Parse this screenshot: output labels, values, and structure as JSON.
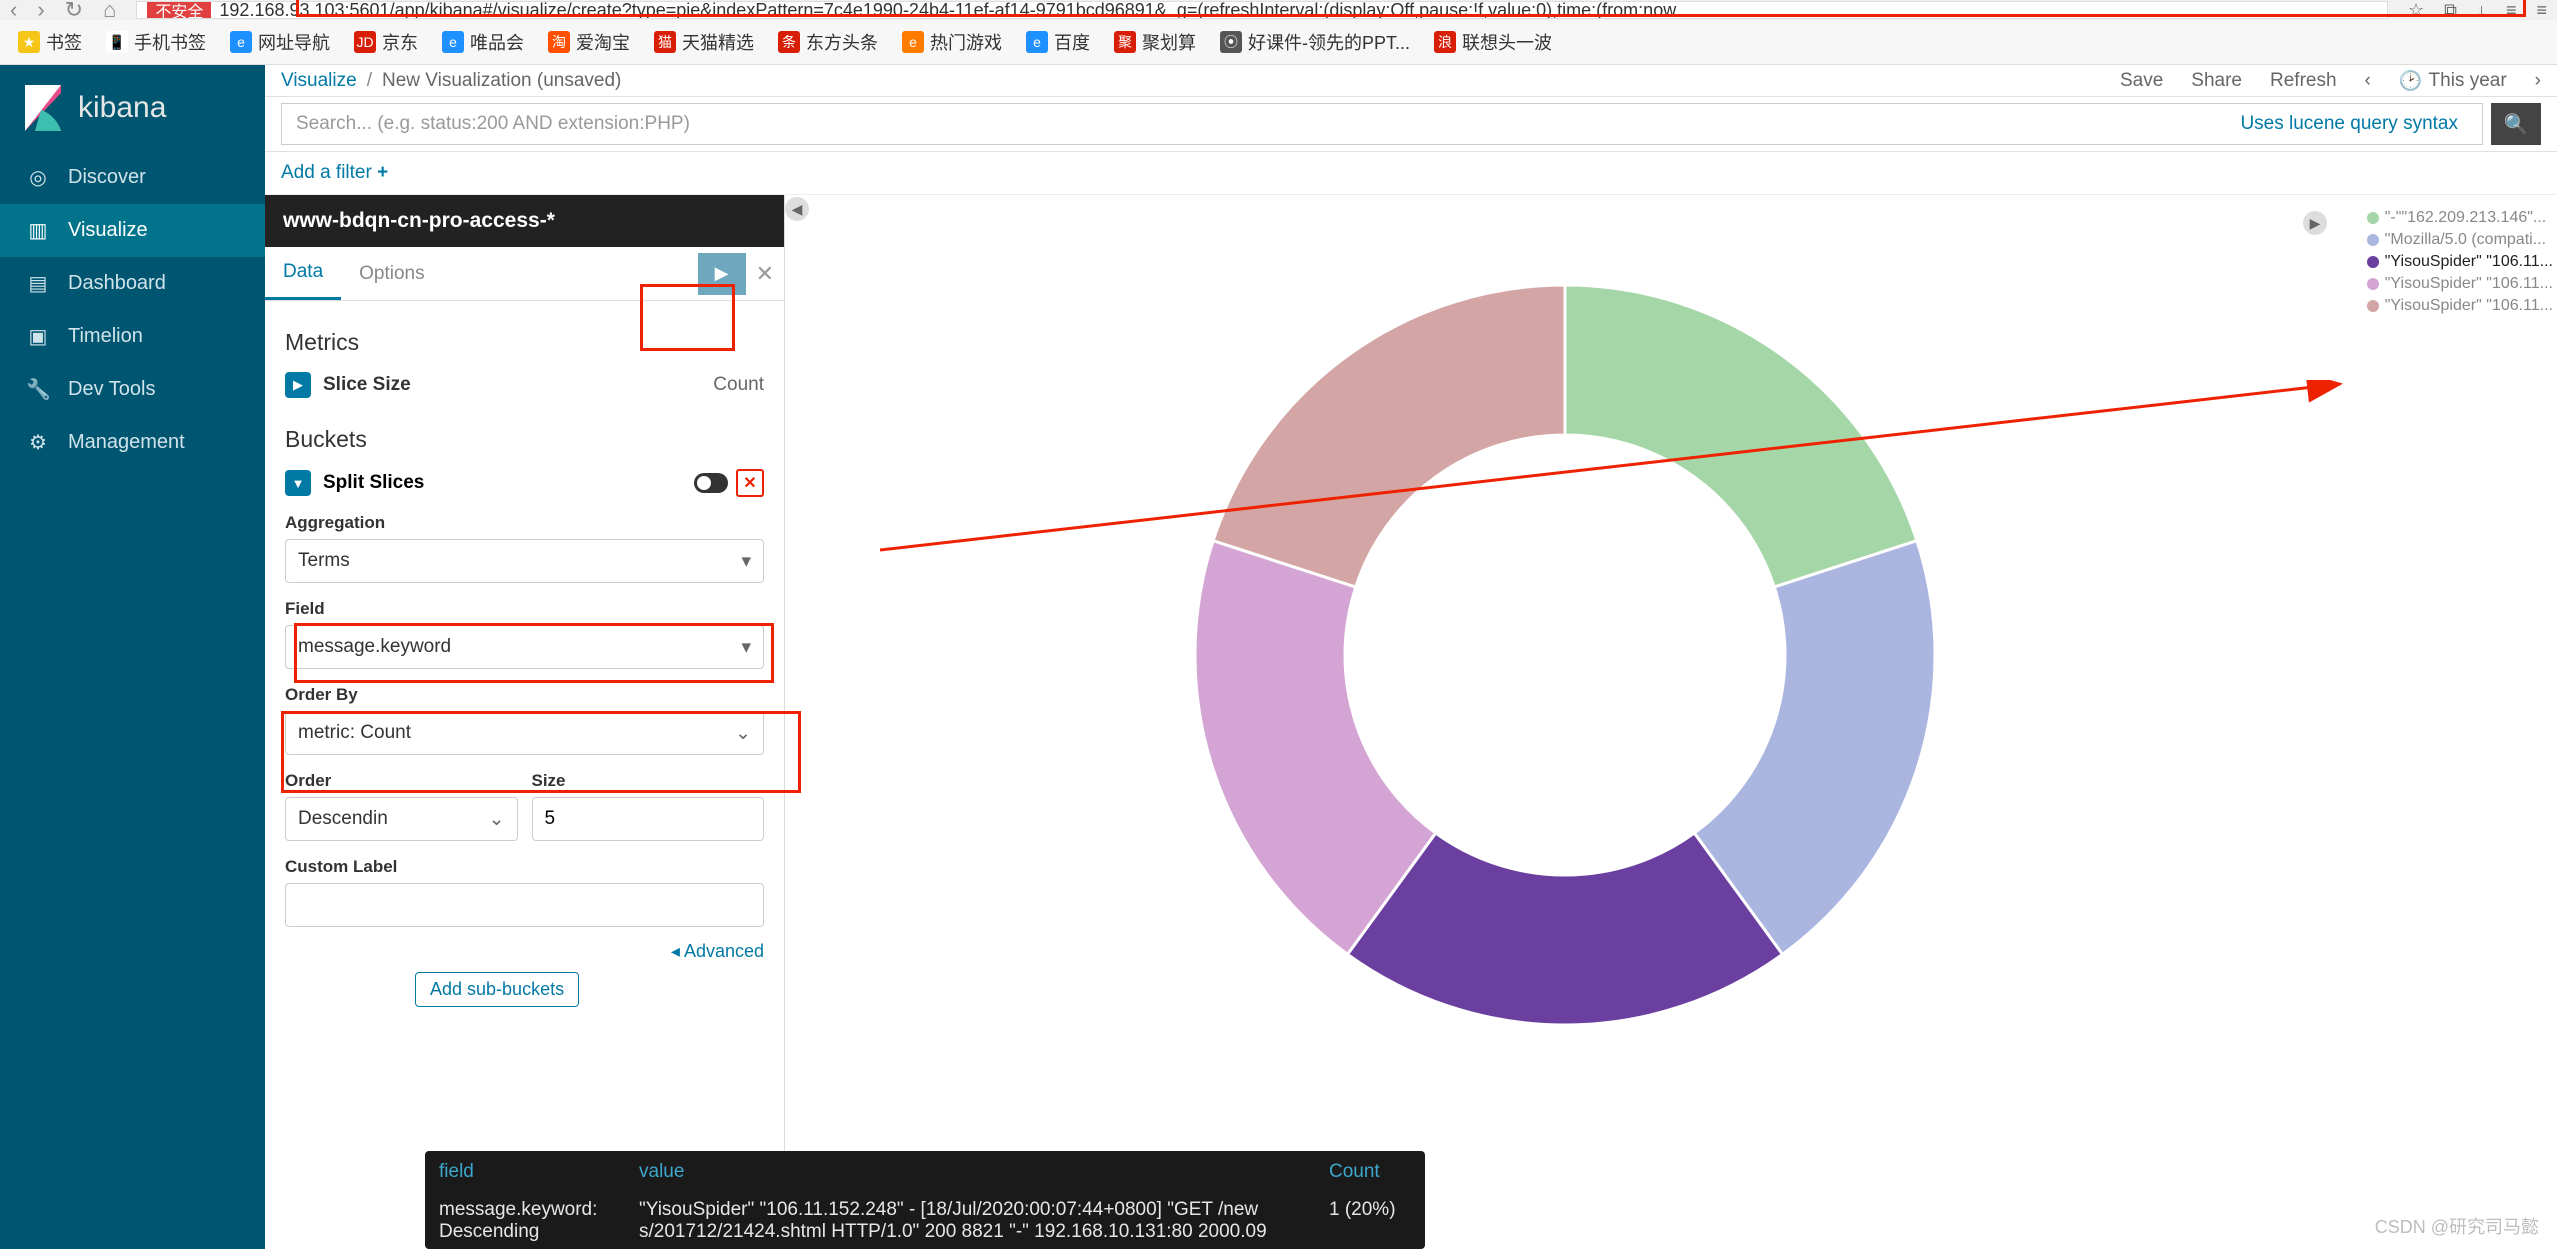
{
  "browser": {
    "url_danger": "不安全",
    "url": "192.168.93.103:5601/app/kibana#/visualize/create?type=pie&indexPattern=7c4e1990-24b4-11ef-af14-9791bcd96891&_g=(refreshInterval:(display:Off,pause:!f,value:0),time:(from:now...",
    "bookmarks": [
      {
        "icon": "★",
        "bg": "#f5c518",
        "label": "书签"
      },
      {
        "icon": "📱",
        "bg": "#fff",
        "label": "手机书签"
      },
      {
        "icon": "e",
        "bg": "#1e90ff",
        "label": "网址导航"
      },
      {
        "icon": "JD",
        "bg": "#d81e06",
        "label": "京东"
      },
      {
        "icon": "e",
        "bg": "#1e90ff",
        "label": "唯品会"
      },
      {
        "icon": "淘",
        "bg": "#ff5000",
        "label": "爱淘宝"
      },
      {
        "icon": "猫",
        "bg": "#d81e06",
        "label": "天猫精选"
      },
      {
        "icon": "条",
        "bg": "#d81e06",
        "label": "东方头条"
      },
      {
        "icon": "e",
        "bg": "#ff7b00",
        "label": "热门游戏"
      },
      {
        "icon": "e",
        "bg": "#1e90ff",
        "label": "百度"
      },
      {
        "icon": "聚",
        "bg": "#d81e06",
        "label": "聚划算"
      },
      {
        "icon": "⦿",
        "bg": "#555",
        "label": "好课件-领先的PPT..."
      },
      {
        "icon": "浪",
        "bg": "#d81e06",
        "label": "联想头一波"
      }
    ]
  },
  "sidebar": {
    "brand": "kibana",
    "items": [
      {
        "icon": "◎",
        "label": "Discover"
      },
      {
        "icon": "▥",
        "label": "Visualize"
      },
      {
        "icon": "▤",
        "label": "Dashboard"
      },
      {
        "icon": "▣",
        "label": "Timelion"
      },
      {
        "icon": "🔧",
        "label": "Dev Tools"
      },
      {
        "icon": "⚙",
        "label": "Management"
      }
    ]
  },
  "header": {
    "crumb1": "Visualize",
    "crumb2": "New Visualization (unsaved)",
    "actions": [
      "Save",
      "Share",
      "Refresh"
    ],
    "time": "This year"
  },
  "search": {
    "placeholder": "Search... (e.g. status:200 AND extension:PHP)",
    "lucene": "Uses lucene query syntax"
  },
  "filter_add": "Add a filter",
  "editor": {
    "title": "www-bdqn-cn-pro-access-*",
    "tabs": [
      "Data",
      "Options"
    ],
    "metrics_h": "Metrics",
    "metric_label": "Slice Size",
    "metric_agg": "Count",
    "buckets_h": "Buckets",
    "bucket_label": "Split Slices",
    "agg_label": "Aggregation",
    "agg_value": "Terms",
    "field_label": "Field",
    "field_value": "message.keyword",
    "orderby_label": "Order By",
    "orderby_value": "metric: Count",
    "order_label": "Order",
    "order_value": "Descendin",
    "size_label": "Size",
    "size_value": "5",
    "custom_label": "Custom Label",
    "advanced": "Advanced",
    "add_sub": "Add sub-buckets"
  },
  "legend": [
    {
      "color": "#a5d6a7",
      "label": "\"-\"\"162.209.213.146\"...",
      "sel": false
    },
    {
      "color": "#aab6e0",
      "label": "\"Mozilla/5.0 (compati...",
      "sel": false
    },
    {
      "color": "#6b3fa0",
      "label": "\"YisouSpider\" \"106.11...",
      "sel": true
    },
    {
      "color": "#d4a5d4",
      "label": "\"YisouSpider\" \"106.11...",
      "sel": false
    },
    {
      "color": "#d4a5a5",
      "label": "\"YisouSpider\" \"106.11...",
      "sel": false
    }
  ],
  "tooltip": {
    "headers": [
      "field",
      "value",
      "Count"
    ],
    "field": "message.keyword: Descending",
    "value": "\"YisouSpider\" \"106.11.152.248\" - [18/Jul/2020:00:07:44+0800] \"GET /new s/201712/21424.shtml HTTP/1.0\" 200 8821 \"-\" 192.168.10.131:80 2000.09",
    "count": "1 (20%)"
  },
  "watermark": "CSDN @研究司马懿",
  "chart_data": {
    "type": "pie",
    "donut": true,
    "title": "",
    "series": [
      {
        "name": "\"-\"\"162.209.213.146\"",
        "value": 20,
        "color": "#a5d6a7"
      },
      {
        "name": "\"Mozilla/5.0 (compati...",
        "value": 20,
        "color": "#aab6e0"
      },
      {
        "name": "\"YisouSpider\" \"106.11... (a)",
        "value": 20,
        "color": "#6b3fa0"
      },
      {
        "name": "\"YisouSpider\" \"106.11... (b)",
        "value": 20,
        "color": "#d4a5d4"
      },
      {
        "name": "\"YisouSpider\" \"106.11... (c)",
        "value": 20,
        "color": "#d4a5a5"
      }
    ]
  }
}
